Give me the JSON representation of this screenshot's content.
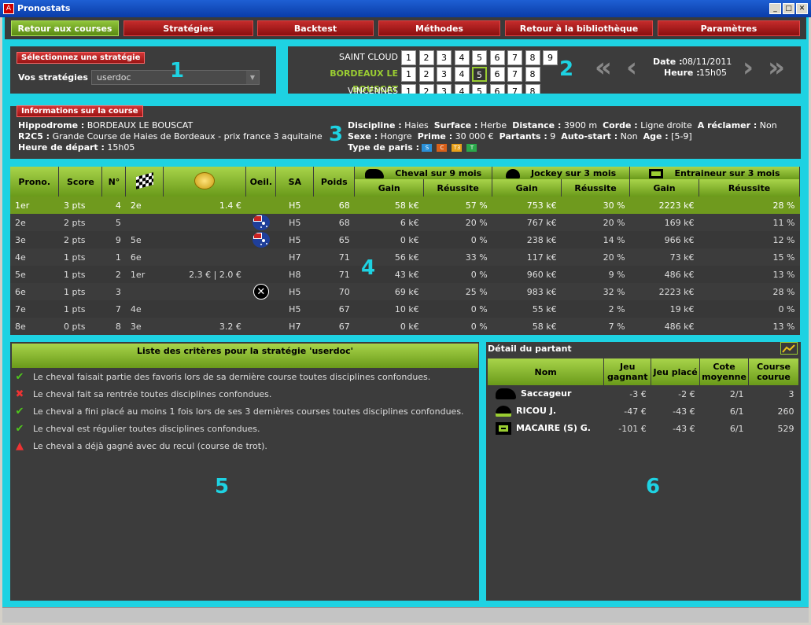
{
  "window": {
    "title": "Pronostats"
  },
  "nav": [
    {
      "label": "Retour aux courses",
      "active": true
    },
    {
      "label": "Stratégies"
    },
    {
      "label": "Backtest"
    },
    {
      "label": "Méthodes"
    },
    {
      "label": "Retour à la bibliothèque"
    },
    {
      "label": "Paramètres"
    }
  ],
  "strategy": {
    "section_label": "Sélectionnez une stratégie",
    "field_label": "Vos stratégies",
    "selected": "userdoc",
    "marker": "1"
  },
  "tracks": {
    "marker": "2",
    "rows": [
      {
        "name": "SAINT CLOUD",
        "races": [
          "1",
          "2",
          "3",
          "4",
          "5",
          "6",
          "7",
          "8",
          "9"
        ]
      },
      {
        "name": "BORDEAUX LE BOUSCAT",
        "races": [
          "1",
          "2",
          "3",
          "4",
          "5",
          "6",
          "7",
          "8"
        ],
        "current": true,
        "selected_race": "5"
      },
      {
        "name": "VINCENNES",
        "races": [
          "1",
          "2",
          "3",
          "4",
          "5",
          "6",
          "7",
          "8"
        ]
      }
    ],
    "date_label": "Date :",
    "date": "08/11/2011",
    "time_label": "Heure :",
    "time": "15h05"
  },
  "race": {
    "section_label": "Informations sur la course",
    "marker": "3",
    "hippodrome_label": "Hippodrome :",
    "hippodrome": "BORDEAUX LE BOUSCAT",
    "code": "R2C5 :",
    "name": "Grande Course de Haies de Bordeaux - prix france 3 aquitaine",
    "start_label": "Heure de départ :",
    "start": "15h05",
    "discipline_label": "Discipline :",
    "discipline": "Haies",
    "surface_label": "Surface :",
    "surface": "Herbe",
    "distance_label": "Distance :",
    "distance": "3900 m",
    "corde_label": "Corde :",
    "corde": "Ligne droite",
    "reclamer_label": "A réclamer :",
    "reclamer": "Non",
    "sexe_label": "Sexe :",
    "sexe": "Hongre",
    "prime_label": "Prime :",
    "prime": "30 000 €",
    "partants_label": "Partants :",
    "partants": "9",
    "autostart_label": "Auto-start :",
    "autostart": "Non",
    "age_label": "Age :",
    "age": "[5-9]",
    "paris_label": "Type de paris :",
    "paris": [
      {
        "t": "S",
        "color": "#2a8fd6"
      },
      {
        "t": "C",
        "color": "#d9601a"
      },
      {
        "t": "T3",
        "color": "#e8a019"
      },
      {
        "t": "T",
        "color": "#2aa84a"
      }
    ]
  },
  "table": {
    "marker": "4",
    "headers": {
      "prono": "Prono.",
      "score": "Score",
      "num": "N°",
      "oeil": "Oeil.",
      "sa": "SA",
      "poids": "Poids",
      "cheval": "Cheval sur 9 mois",
      "jockey": "Jockey sur 3 mois",
      "entraineur": "Entraineur sur 3 mois",
      "gain": "Gain",
      "reussite": "Réussite"
    },
    "rows": [
      {
        "prono": "1er",
        "score": "3 pts",
        "num": "4",
        "last": "2e",
        "cote": "1.4 €",
        "oeil": "",
        "sa": "H5",
        "poids": "68",
        "cg": "58 k€",
        "cr": "57 %",
        "jg": "753 k€",
        "jr": "30 %",
        "eg": "2223 k€",
        "er": "28 %",
        "selected": true
      },
      {
        "prono": "2e",
        "score": "2 pts",
        "num": "5",
        "last": "",
        "cote": "",
        "oeil": "flag",
        "sa": "H5",
        "poids": "68",
        "cg": "6 k€",
        "cr": "20 %",
        "jg": "767 k€",
        "jr": "20 %",
        "eg": "169 k€",
        "er": "11 %"
      },
      {
        "prono": "3e",
        "score": "2 pts",
        "num": "9",
        "last": "5e",
        "cote": "",
        "oeil": "flag",
        "sa": "H5",
        "poids": "65",
        "cg": "0 k€",
        "cr": "0 %",
        "jg": "238 k€",
        "jr": "14 %",
        "eg": "966 k€",
        "er": "12 %"
      },
      {
        "prono": "4e",
        "score": "1 pts",
        "num": "1",
        "last": "6e",
        "cote": "",
        "oeil": "",
        "sa": "H7",
        "poids": "71",
        "cg": "56 k€",
        "cr": "33 %",
        "jg": "117 k€",
        "jr": "20 %",
        "eg": "73 k€",
        "er": "15 %"
      },
      {
        "prono": "5e",
        "score": "1 pts",
        "num": "2",
        "last": "1er",
        "cote": "2.3 € | 2.0 €",
        "oeil": "",
        "sa": "H8",
        "poids": "71",
        "cg": "43 k€",
        "cr": "0 %",
        "jg": "960 k€",
        "jr": "9 %",
        "eg": "486 k€",
        "er": "13 %"
      },
      {
        "prono": "6e",
        "score": "1 pts",
        "num": "3",
        "last": "",
        "cote": "",
        "oeil": "x",
        "sa": "H5",
        "poids": "70",
        "cg": "69 k€",
        "cr": "25 %",
        "jg": "983 k€",
        "jr": "32 %",
        "eg": "2223 k€",
        "er": "28 %"
      },
      {
        "prono": "7e",
        "score": "1 pts",
        "num": "7",
        "last": "4e",
        "cote": "",
        "oeil": "",
        "sa": "H5",
        "poids": "67",
        "cg": "10 k€",
        "cr": "0 %",
        "jg": "55 k€",
        "jr": "2 %",
        "eg": "19 k€",
        "er": "0 %"
      },
      {
        "prono": "8e",
        "score": "0 pts",
        "num": "8",
        "last": "3e",
        "cote": "3.2 €",
        "oeil": "",
        "sa": "H7",
        "poids": "67",
        "cg": "0 k€",
        "cr": "0 %",
        "jg": "58 k€",
        "jr": "7 %",
        "eg": "486 k€",
        "er": "13 %"
      }
    ]
  },
  "criteria": {
    "marker": "5",
    "title": "Liste des critères pour la stratégie 'userdoc'",
    "items": [
      {
        "status": "ok",
        "text": "Le cheval faisait partie des favoris lors de sa dernière course toutes disciplines confondues."
      },
      {
        "status": "ko",
        "text": "Le cheval fait sa rentrée toutes disciplines confondues."
      },
      {
        "status": "ok",
        "text": "Le cheval a fini placé au moins 1 fois lors de ses 3 dernières courses toutes disciplines confondues."
      },
      {
        "status": "ok",
        "text": "Le cheval est régulier toutes disciplines confondues."
      },
      {
        "status": "warn",
        "text": "Le cheval a déjà gagné avec du recul (course de trot)."
      }
    ]
  },
  "detail": {
    "marker": "6",
    "title": "Détail du partant",
    "headers": {
      "nom": "Nom",
      "jeu_gagnant": "Jeu gagnant",
      "jeu_place": "Jeu placé",
      "cote": "Cote moyenne",
      "course": "Course courue"
    },
    "rows": [
      {
        "type": "horse",
        "nom": "Saccageur",
        "jg": "-3 €",
        "jp": "-2 €",
        "cote": "2/1",
        "course": "3"
      },
      {
        "type": "jockey",
        "nom": "RICOU J.",
        "jg": "-47 €",
        "jp": "-43 €",
        "cote": "6/1",
        "course": "260"
      },
      {
        "type": "trainer",
        "nom": "MACAIRE (S) G.",
        "jg": "-101 €",
        "jp": "-43 €",
        "cote": "6/1",
        "course": "529"
      }
    ]
  }
}
